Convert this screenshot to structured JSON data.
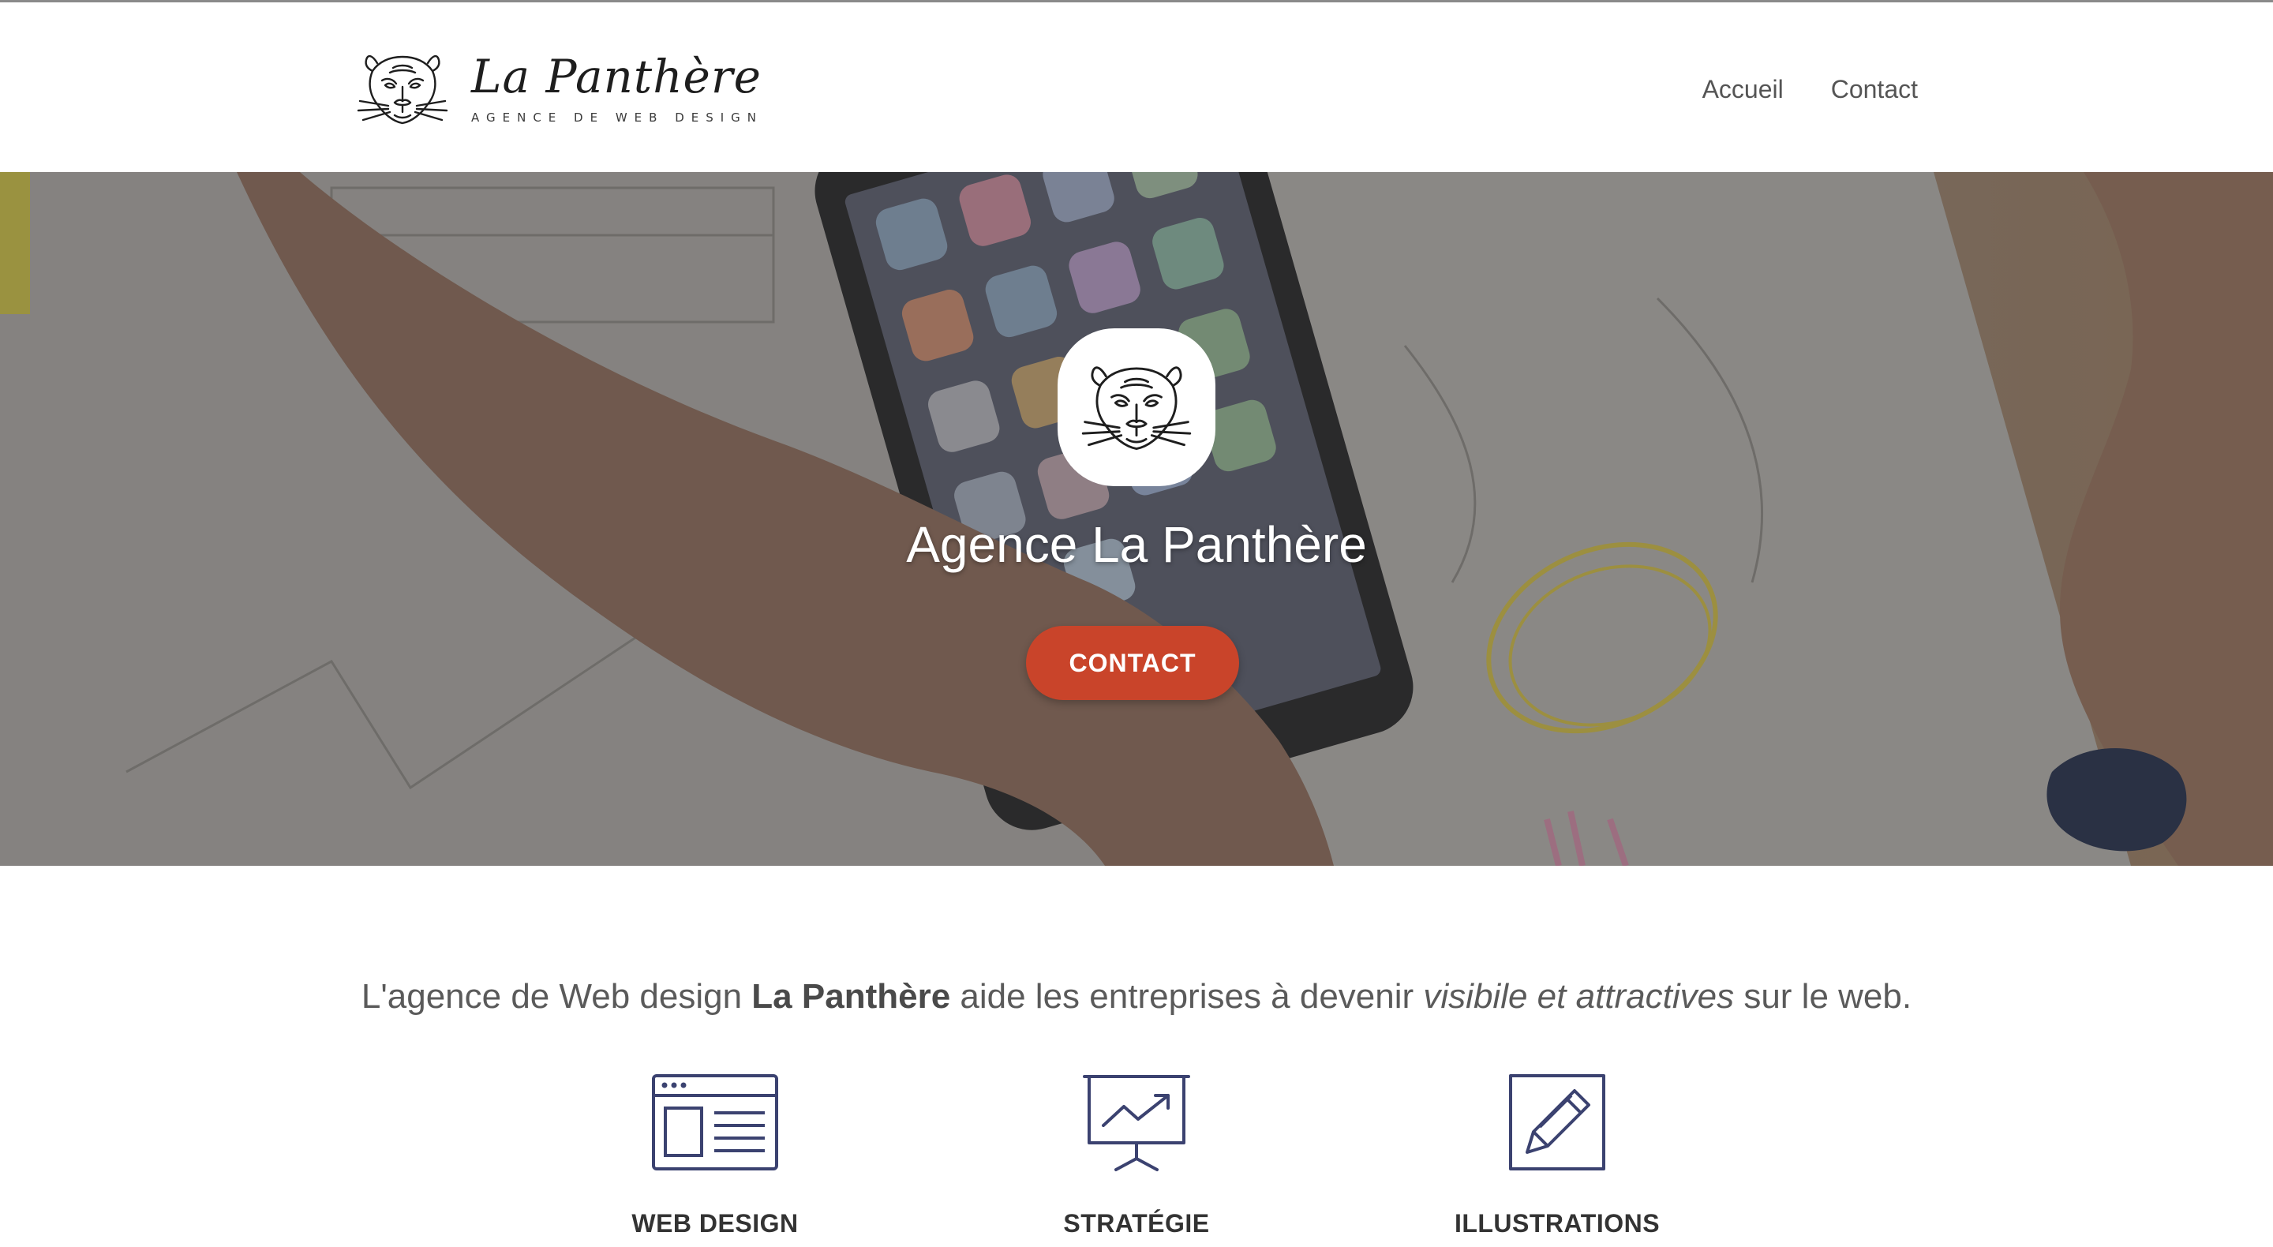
{
  "header": {
    "logo_title": "La Panthère",
    "logo_tagline": "AGENCE DE WEB DESIGN",
    "logo_icon": "panther-head-icon",
    "nav": [
      {
        "label": "Accueil"
      },
      {
        "label": "Contact"
      }
    ]
  },
  "hero": {
    "title": "Agence La Panthère",
    "button_label": "CONTACT",
    "button_color": "#c9442a",
    "logo_icon": "panther-head-icon"
  },
  "intro": {
    "part1": "L'agence de Web design ",
    "bold": "La Panthère",
    "part2": " aide les entreprises à devenir ",
    "italic": "visibile et attractives",
    "part3": " sur le web."
  },
  "services": [
    {
      "label": "WEB DESIGN",
      "icon": "browser-window-icon"
    },
    {
      "label": "STRATÉGIE",
      "icon": "presentation-chart-icon"
    },
    {
      "label": "ILLUSTRATIONS",
      "icon": "pencil-square-icon"
    }
  ],
  "colors": {
    "icon_stroke": "#3b4270",
    "accent": "#c9442a"
  }
}
